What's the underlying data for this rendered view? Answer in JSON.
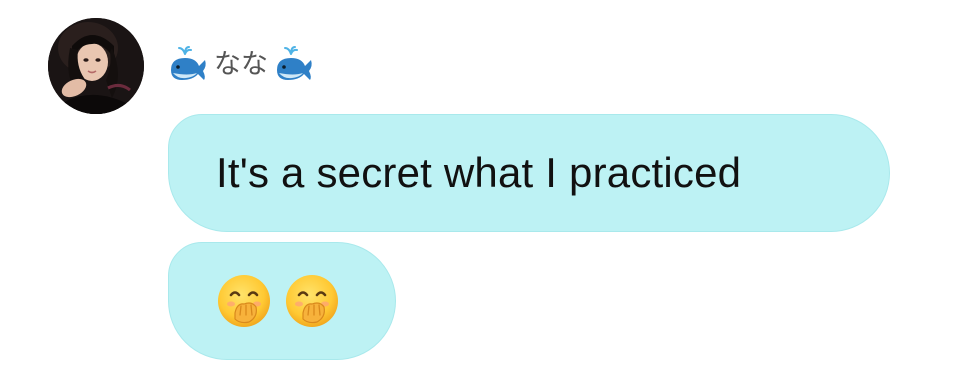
{
  "sender": {
    "display_name": "なな",
    "name_prefix_icon": "spouting-whale-icon",
    "name_suffix_icon": "spouting-whale-icon",
    "avatar_icon": "profile-photo-avatar"
  },
  "messages": [
    {
      "type": "text",
      "text": "It's a secret what I practiced"
    },
    {
      "type": "emoji",
      "emojis": [
        "face-with-hand-over-mouth-icon",
        "face-with-hand-over-mouth-icon"
      ]
    }
  ],
  "colors": {
    "bubble_fill": "#bdf2f4",
    "bubble_border": "#a9e9ec",
    "name_text": "#555555",
    "message_text": "#111111"
  }
}
